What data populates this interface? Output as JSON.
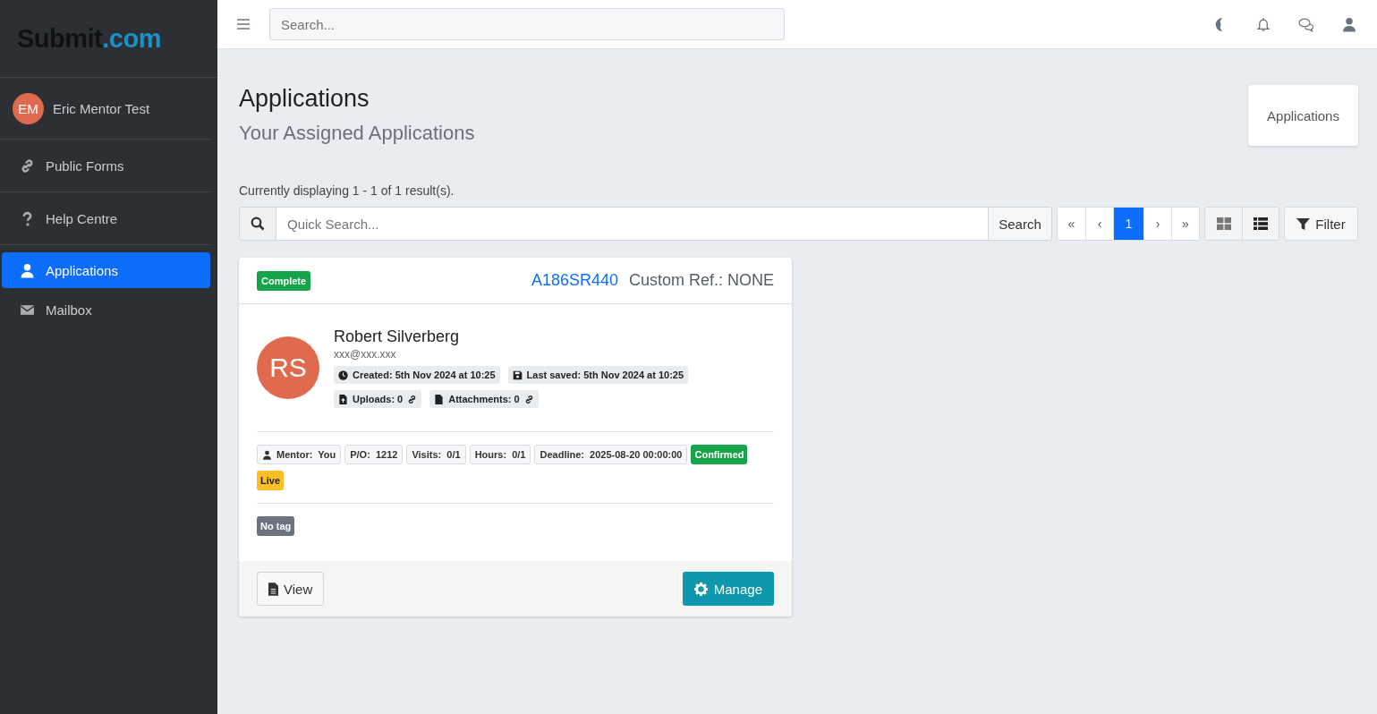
{
  "logo": {
    "main": "Submit",
    "suffix": ".com"
  },
  "user": {
    "initials": "EM",
    "name": "Eric Mentor Test"
  },
  "sidebar": {
    "items": [
      {
        "kind": "link",
        "label": "Public Forms",
        "selected": false
      },
      {
        "kind": "help",
        "label": "Help Centre",
        "selected": false
      },
      {
        "kind": "user",
        "label": "Applications",
        "selected": true
      },
      {
        "kind": "mail",
        "label": "Mailbox",
        "selected": false
      }
    ]
  },
  "topbar": {
    "search": {
      "placeholder": "Search..."
    }
  },
  "page": {
    "title": "Applications",
    "subtitle": "Your Assigned Applications",
    "breadcrumb": "Applications",
    "result_count": "Currently displaying 1 - 1 of 1 result(s)."
  },
  "toolbar": {
    "quick_search": {
      "placeholder": "Quick Search..."
    },
    "search_button": "Search",
    "pagination": [
      {
        "label": "«",
        "selected": false
      },
      {
        "label": "‹",
        "selected": false
      },
      {
        "label": "1",
        "selected": true
      },
      {
        "label": "›",
        "selected": false
      },
      {
        "label": "»",
        "selected": false
      }
    ],
    "view_modes": [
      {
        "kind": "grid",
        "selected": false
      },
      {
        "kind": "list",
        "selected": true
      }
    ],
    "filter_button": "Filter"
  },
  "card": {
    "status": "Complete",
    "reference": "A186SR440",
    "custom_ref": "Custom Ref.: NONE",
    "applicant": {
      "initials": "RS",
      "name": "Robert Silverberg",
      "email": "xxx@xxx.xxx"
    },
    "meta": [
      {
        "kind": "clock",
        "text": "Created: 5th Nov 2024 at 10:25",
        "linked": false
      },
      {
        "kind": "save",
        "text": "Last saved: 5th Nov 2024 at 10:25",
        "linked": false
      },
      {
        "kind": "upload",
        "text": "Uploads: 0",
        "linked": true
      },
      {
        "kind": "file",
        "text": "Attachments: 0",
        "linked": true
      }
    ],
    "details": [
      {
        "kind": "user",
        "label": "Mentor:",
        "value": "You"
      },
      {
        "kind": "plain",
        "label": "P/O:",
        "value": "1212"
      },
      {
        "kind": "plain",
        "label": "Visits:",
        "value": "0/1"
      },
      {
        "kind": "plain",
        "label": "Hours:",
        "value": "0/1"
      },
      {
        "kind": "plain",
        "label": "Deadline:",
        "value": "2025-08-20 00:00:00"
      }
    ],
    "badges": [
      {
        "text": "Confirmed",
        "color": "#16a34a"
      },
      {
        "text": "Live",
        "color": "#fbbf24"
      }
    ],
    "tags": [
      "No tag"
    ],
    "view_button": "View",
    "manage_button": "Manage"
  }
}
